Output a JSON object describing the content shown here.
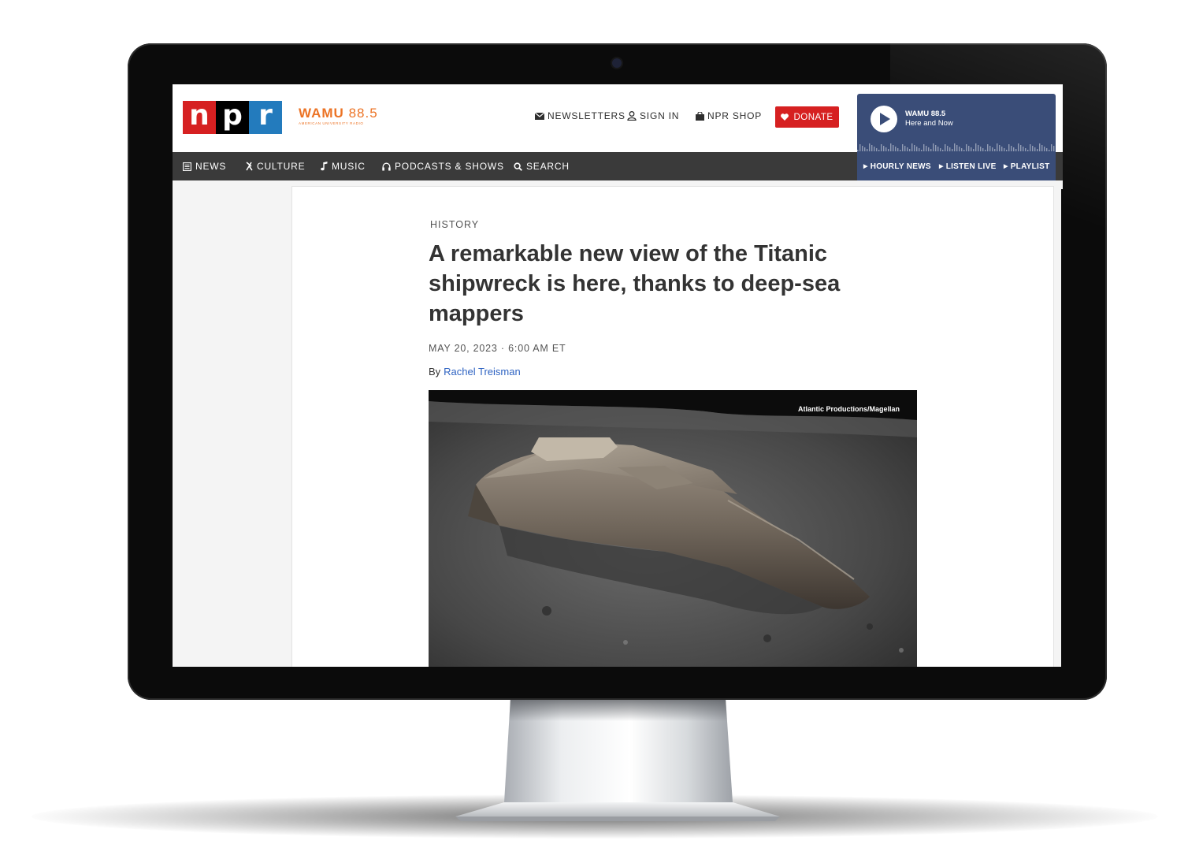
{
  "header": {
    "logo_letters": [
      "n",
      "p",
      "r"
    ],
    "station_logo": {
      "bold": "WAMU",
      "freq": "88.5",
      "subtitle": "AMERICAN UNIVERSITY RADIO"
    },
    "newsletters": "NEWSLETTERS",
    "sign_in": "SIGN IN",
    "shop": "NPR SHOP",
    "donate": "DONATE"
  },
  "player": {
    "station": "WAMU 88.5",
    "program": "Here and Now",
    "links": [
      "HOURLY NEWS",
      "LISTEN LIVE",
      "PLAYLIST"
    ]
  },
  "nav": {
    "items": [
      "NEWS",
      "CULTURE",
      "MUSIC",
      "PODCASTS & SHOWS",
      "SEARCH"
    ]
  },
  "article": {
    "slug": "HISTORY",
    "headline": "A remarkable new view of the Titanic shipwreck is here, thanks to deep-sea mappers",
    "dateline": "MAY 20, 2023 · 6:00 AM ET",
    "byline_prefix": "By",
    "author": "Rachel Treisman",
    "photo_credit": "Atlantic Productions/Magellan"
  },
  "colors": {
    "npr_red": "#d62021",
    "npr_black": "#000000",
    "npr_blue": "#237bbd",
    "wamu_orange": "#ec7325",
    "player_blue": "#3a4d78",
    "nav_gray": "#3a3a3a",
    "link_blue": "#2e63c2"
  },
  "icons": [
    "envelope-icon",
    "user-icon",
    "bag-icon",
    "heart-icon",
    "play-icon",
    "newspaper-icon",
    "culture-icon",
    "music-note-icon",
    "headphones-icon",
    "search-icon"
  ]
}
